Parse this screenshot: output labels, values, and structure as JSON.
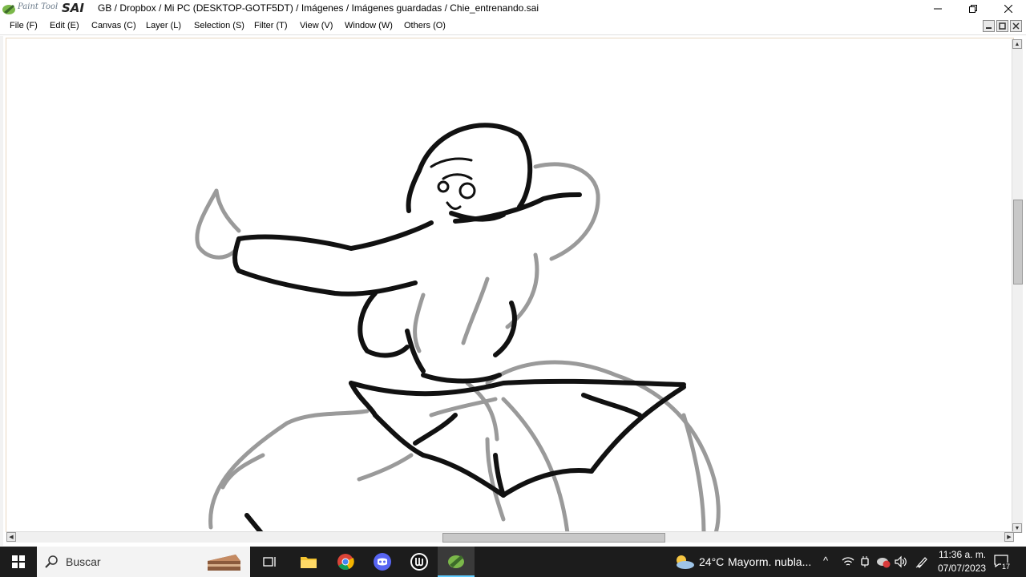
{
  "app": {
    "logo_small": "Paint Tool",
    "logo_big": "SAI",
    "title": "GB / Dropbox / Mi PC (DESKTOP-GOTF5DT) / Imágenes / Imágenes guardadas / Chie_entrenando.sai"
  },
  "window_controls": {
    "minimize_icon": "minimize-icon",
    "restore_icon": "restore-icon",
    "close_icon": "close-icon"
  },
  "menu": {
    "items": [
      {
        "label": "File (F)"
      },
      {
        "label": "Edit (E)"
      },
      {
        "label": "Canvas (C)"
      },
      {
        "label": "Layer (L)"
      },
      {
        "label": "Selection (S)"
      },
      {
        "label": "Filter (T)"
      },
      {
        "label": "View (V)"
      },
      {
        "label": "Window (W)"
      },
      {
        "label": "Others (O)"
      }
    ]
  },
  "canvas": {
    "content": "sketch of a girl",
    "vertical_scroll_fraction": 0.33,
    "horizontal_scroll_fraction": 0.43
  },
  "taskbar": {
    "search_placeholder": "Buscar",
    "weather_temp": "24°C",
    "weather_text": "Mayorm. nubla...",
    "time": "11:36 a. m.",
    "date": "07/07/2023",
    "notification_count": "17",
    "colors": {
      "background": "#1c1c1c",
      "accent": "#60cdff"
    }
  }
}
